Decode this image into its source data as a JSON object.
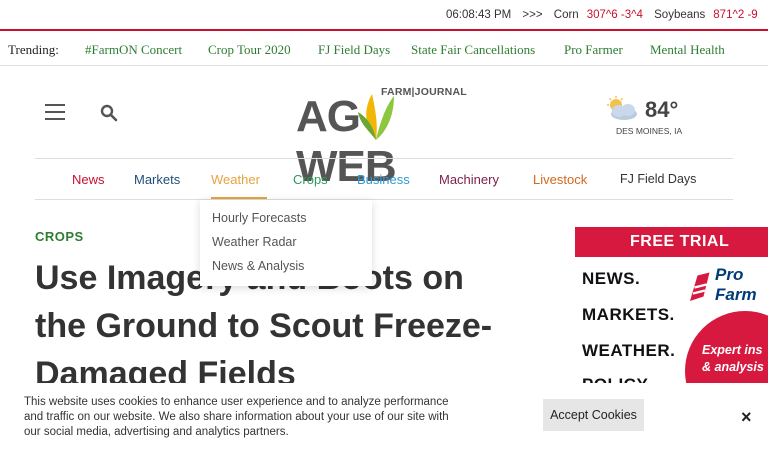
{
  "ticker": {
    "time": "06:08:43 PM",
    "arrows": ">>>",
    "corn_label": "Corn",
    "corn_value": "307^6 -3^4",
    "soybeans_label": "Soybeans",
    "soybeans_value": "871^2 -9"
  },
  "trending": {
    "label": "Trending:",
    "items": [
      "#FarmON Concert",
      "Crop Tour 2020",
      "FJ Field Days",
      "State Fair Cancellations",
      "Pro Farmer",
      "Mental Health"
    ]
  },
  "logo": {
    "farm_journal": "FARM|JOURNAL",
    "ag": "AG",
    "web": "WEB"
  },
  "weather": {
    "temp": "84°",
    "location": "DES MOINES, IA",
    "icon": "partly-sunny-icon"
  },
  "nav": {
    "items": [
      "News",
      "Markets",
      "Weather",
      "Crops",
      "Business",
      "Machinery",
      "Livestock",
      "FJ Field Days"
    ],
    "colors": [
      "#c8102e",
      "#1f4e79",
      "#e8a33c",
      "#2e9b5a",
      "#2e9bd6",
      "#7a1f4a",
      "#d2691e",
      "#333333"
    ]
  },
  "dropdown": {
    "items": [
      "Hourly Forecasts",
      "Weather Radar",
      "News & Analysis"
    ]
  },
  "article": {
    "category": "CROPS",
    "headline_lines": [
      "Use Imagery and Boots on",
      "the Ground to Scout Freeze-",
      "Damaged Fields"
    ]
  },
  "ad": {
    "banner": "FREE TRIAL",
    "words": [
      "NEWS.",
      "MARKETS.",
      "WEATHER.",
      "POLICY."
    ],
    "brand1": "Pro",
    "brand2": "Farm",
    "pitch1": "Expert ins",
    "pitch2": "& analysis"
  },
  "cookie": {
    "text": "This website uses cookies to enhance user experience and to analyze performance and traffic on our website. We also share information about your use of our site with our social media, advertising and analytics partners.",
    "accept_label": "Accept Cookies",
    "close_label": "×"
  },
  "colors": {
    "accent_red": "#c8102e",
    "green": "#2e7d32",
    "logo_green": "#8dc63f",
    "logo_yellow": "#f2b705"
  }
}
